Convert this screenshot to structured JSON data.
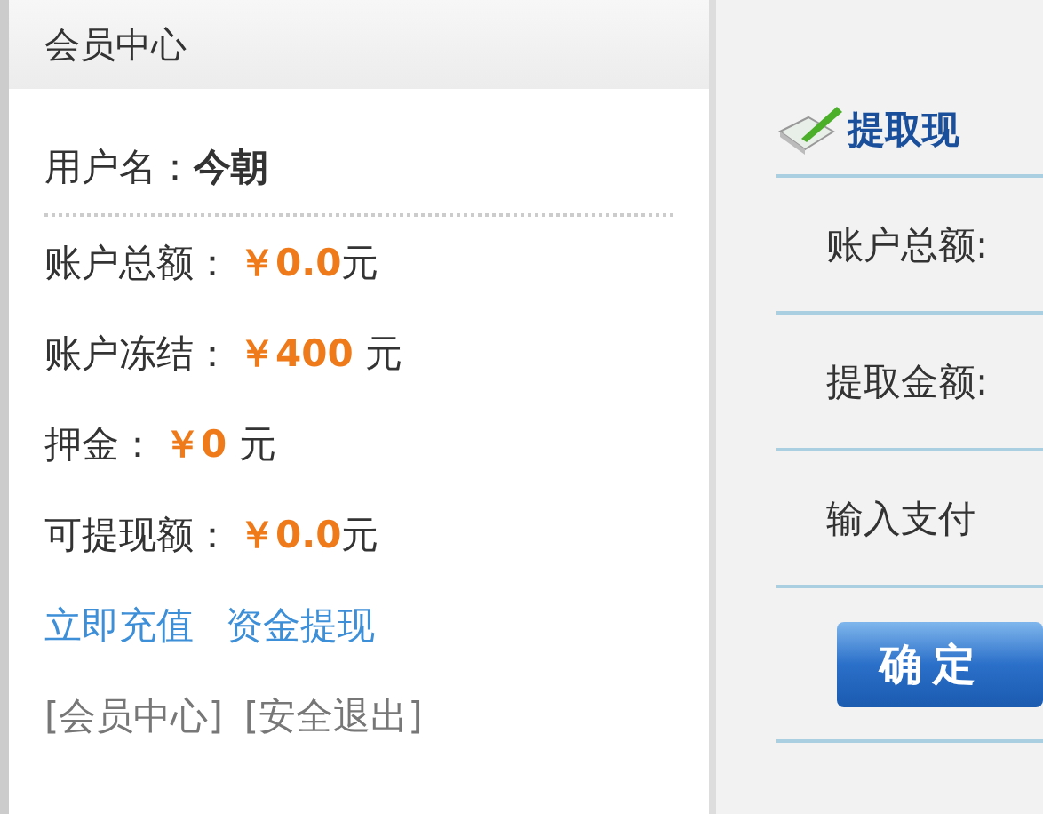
{
  "sidebar": {
    "title": "会员中心",
    "username": {
      "label": "用户名：",
      "value": "今朝"
    },
    "balances": [
      {
        "label": "账户总额：",
        "amount": "￥0.0",
        "unit": "元"
      },
      {
        "label": "账户冻结：",
        "amount": "￥400",
        "unit": " 元"
      },
      {
        "label": "押金：",
        "amount": "￥0",
        "unit": " 元"
      },
      {
        "label": "可提现额：",
        "amount": "￥0.0",
        "unit": "元"
      }
    ],
    "actions": [
      "立即充值",
      "资金提现"
    ],
    "footer_links": [
      "[会员中心]",
      "[安全退出]"
    ]
  },
  "withdraw": {
    "title": "提取现",
    "fields": [
      "账户总额:",
      "提取金额:",
      "输入支付"
    ],
    "button": "确定"
  }
}
